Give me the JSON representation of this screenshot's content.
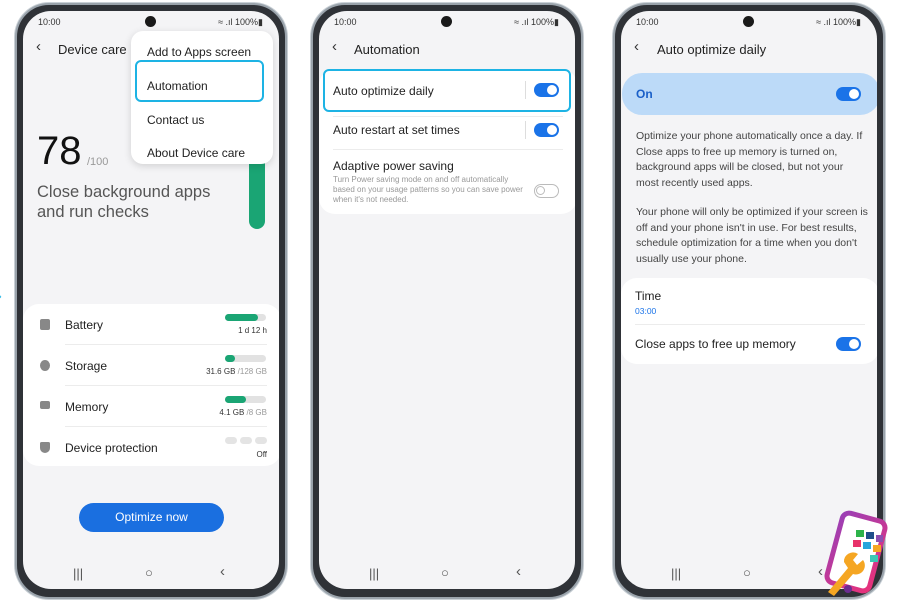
{
  "status": {
    "time": "10:00",
    "battery": "100%"
  },
  "screen1": {
    "title": "Device care",
    "menu": [
      "Add to Apps screen",
      "Automation",
      "Contact us",
      "About Device care"
    ],
    "score": "78",
    "score_max": "/100",
    "message_line1": "Close background apps",
    "message_line2": "and run checks",
    "items": [
      {
        "label": "Battery",
        "value": "1 d 12 h",
        "max": "",
        "fill": 0.8,
        "icon": "battery-icon"
      },
      {
        "label": "Storage",
        "value": "31.6 GB",
        "max": " /128 GB",
        "fill": 0.25,
        "icon": "storage-icon"
      },
      {
        "label": "Memory",
        "value": "4.1 GB",
        "max": " /8 GB",
        "fill": 0.51,
        "icon": "memory-icon"
      },
      {
        "label": "Device protection",
        "value": "Off",
        "max": "",
        "fill": 0,
        "icon": "shield-icon"
      }
    ],
    "button": "Optimize now"
  },
  "screen2": {
    "title": "Automation",
    "rows": [
      {
        "label": "Auto optimize daily",
        "on": true
      },
      {
        "label": "Auto restart at set times",
        "on": true
      },
      {
        "label": "Adaptive power saving",
        "on": false,
        "desc": "Turn Power saving mode on and off automatically based on your usage patterns so you can save power when it's not needed."
      }
    ]
  },
  "screen3": {
    "title": "Auto optimize daily",
    "master_label": "On",
    "para1": "Optimize your phone automatically once a day. If Close apps to free up memory is turned on, background apps will be closed, but not your most recently used apps.",
    "para2": "Your phone will only be optimized if your screen is off and your phone isn't in use. For best results, schedule optimization for a time when you don't usually use your phone.",
    "time_label": "Time",
    "time_value": "03:00",
    "close_apps_label": "Close apps to free up memory",
    "close_apps_on": true
  },
  "colors": {
    "accent": "#1a73e8",
    "highlight": "#1db3e4",
    "green": "#1aa574",
    "on_bar": "#bcdaf8"
  }
}
